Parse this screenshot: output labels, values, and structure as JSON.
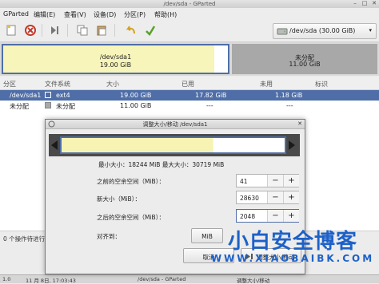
{
  "window": {
    "title": "/dev/sda - GParted"
  },
  "menu": [
    "GParted",
    "编辑(E)",
    "查看(V)",
    "设备(D)",
    "分区(P)",
    "帮助(H)"
  ],
  "toolbar": {
    "device_label": "/dev/sda  (30.00 GiB)"
  },
  "diskmap": {
    "sda1": {
      "name": "/dev/sda1",
      "size": "19.00 GiB"
    },
    "unalloc": {
      "name": "未分配",
      "size": "11.00 GiB"
    }
  },
  "table": {
    "headers": [
      "分区",
      "文件系统",
      "大小",
      "已用",
      "未用",
      "标识"
    ],
    "rows": [
      {
        "partition": "/dev/sda1",
        "filesystem": "ext4",
        "size": "19.00 GiB",
        "used": "17.82 GiB",
        "unused": "1.18 GiB",
        "flags": ""
      },
      {
        "partition": "未分配",
        "filesystem": "未分配",
        "size": "11.00 GiB",
        "used": "---",
        "unused": "---",
        "flags": ""
      }
    ]
  },
  "status": {
    "text": "0 个操作待进行"
  },
  "panel": {
    "left": "1.0",
    "date": "11 月 8日, 17:03:43",
    "app1": "/dev/sda - GParted",
    "app2": "调整大小/移动"
  },
  "dialog": {
    "title": "调整大小/移动 /dev/sda1",
    "min_max": "最小大小：18244 MiB    最大大小：30719 MiB",
    "free_before_label": "之前的空余空间（MiB）：",
    "free_before_value": "41",
    "new_size_label": "新大小（MiB）：",
    "new_size_value": "28630",
    "free_after_label": "之后的空余空间（MiB）：",
    "free_after_value": "2048",
    "align_label": "对齐到：",
    "align_value": "MiB",
    "cancel_label": "取消",
    "resize_label": "调整大小/移动",
    "minus": "−",
    "plus": "+"
  },
  "watermark": {
    "main": "小白安全博客",
    "sub": "WWW.XIAOBAIBK.COM"
  },
  "colors": {
    "accent": "#4f6ea8",
    "partition_fill": "#f7f5b9",
    "unallocated": "#a8a8a8",
    "watermark": "#1d61c8"
  }
}
